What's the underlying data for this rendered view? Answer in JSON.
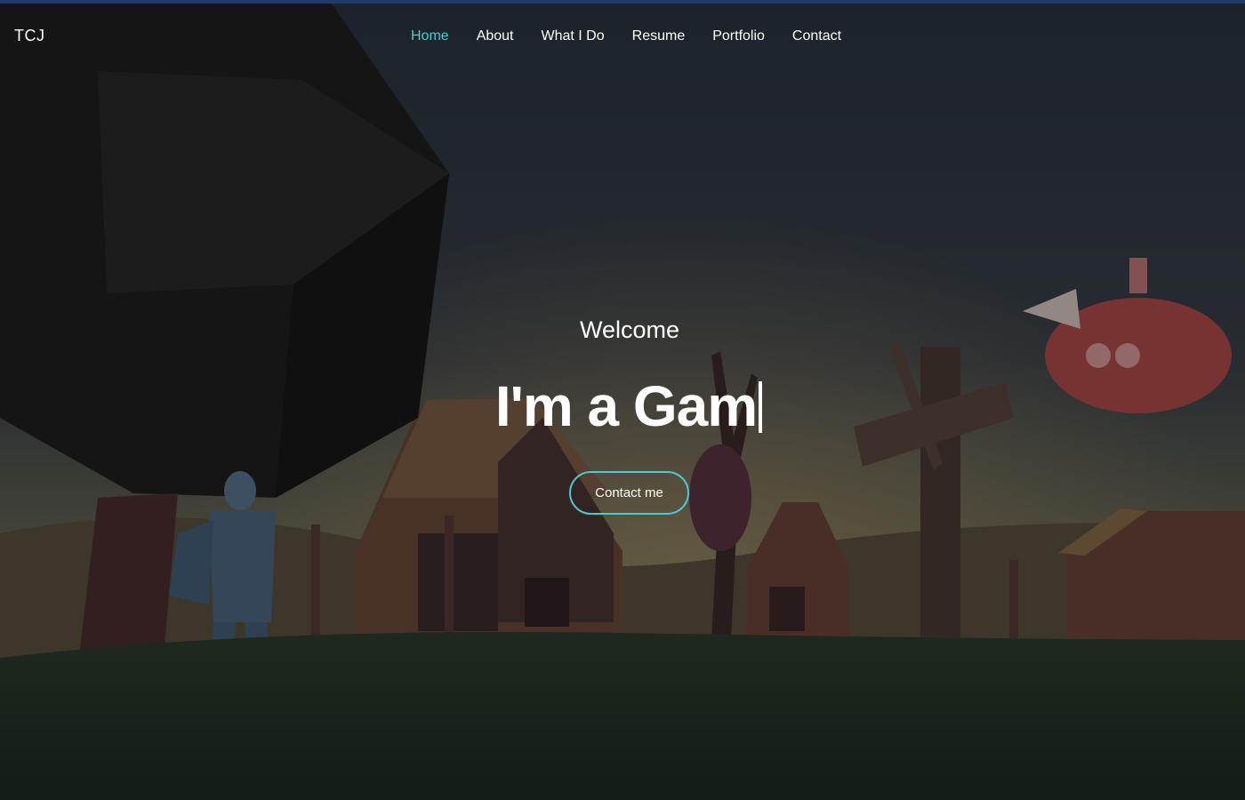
{
  "brand": {
    "name": "TCJ"
  },
  "nav": {
    "items": [
      {
        "label": "Home",
        "active": true
      },
      {
        "label": "About",
        "active": false
      },
      {
        "label": "What I Do",
        "active": false
      },
      {
        "label": "Resume",
        "active": false
      },
      {
        "label": "Portfolio",
        "active": false
      },
      {
        "label": "Contact",
        "active": false
      }
    ]
  },
  "hero": {
    "welcome": "Welcome",
    "typed_text": "I'm a Gam",
    "cta_label": "Contact me"
  },
  "colors": {
    "accent": "#4ec9cf",
    "top_strip": "#1e3a6e",
    "text": "#ffffff",
    "overlay": "#000000"
  }
}
